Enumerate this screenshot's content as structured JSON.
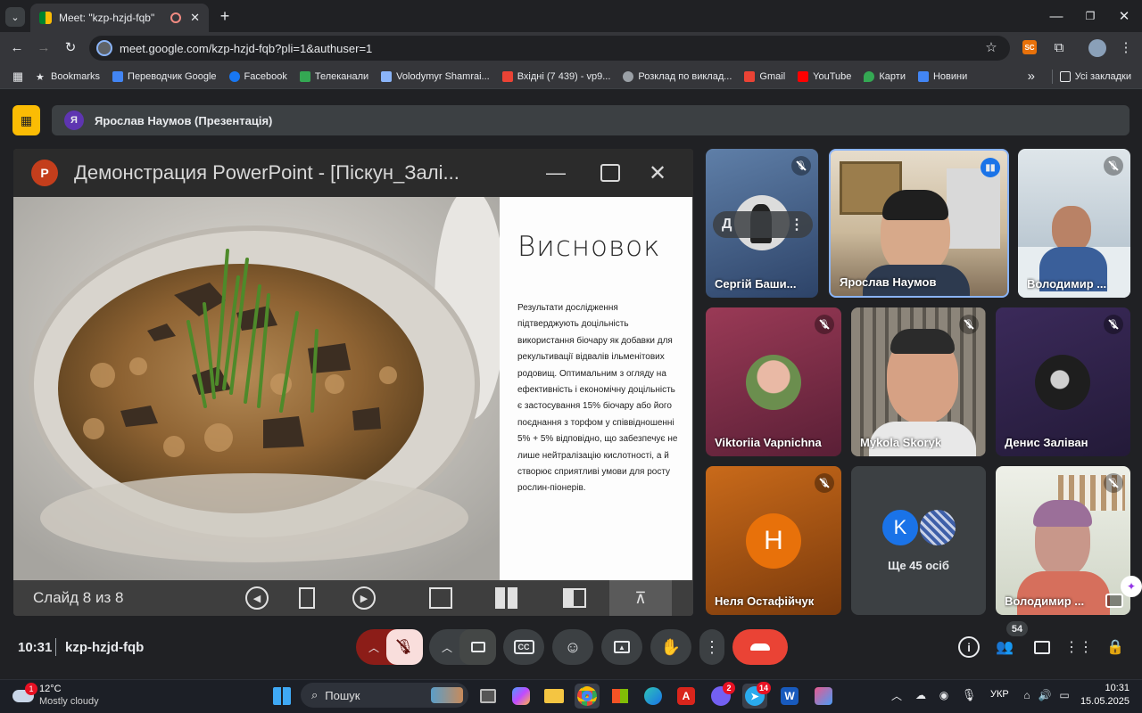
{
  "browser": {
    "tab_title": "Meet: \"kzp-hzjd-fqb\"",
    "url": "meet.google.com/kzp-hzjd-fqb?pli=1&authuser=1",
    "bookmarks": [
      "Bookmarks",
      "Переводчик Google",
      "Facebook",
      "Телеканали",
      "Volodymyr Shamrai...",
      "Вхідні (7 439) - vp9...",
      "Розклад по виклад...",
      "Gmail",
      "YouTube",
      "Карти",
      "Новини"
    ],
    "all_bookmarks": "Усі закладки",
    "ext_badge": "SC"
  },
  "meet": {
    "presenter_initial": "Я",
    "presenter_label": "Ярослав Наумов (Презентація)",
    "slide": {
      "window_title": "Демонстрация PowerPoint - [Піскун_Залі...",
      "heading": "Висновок",
      "body": "Результати дослідження підтверджують доцільність використання біочару як добавки для рекультивації відвалів ільменітових родовищ. Оптимальним з огляду на ефективність і економічну доцільність є застосування 15% біочару або його поєднання з торфом у співвідношенні 5% + 5% відповідно, що забезпечує не лише нейтралізацію кислотності, а й створює сприятливі умови для росту рослин-піонерів.",
      "counter": "Слайд 8 из 8"
    },
    "participants": [
      {
        "name": "Сергій Баши...",
        "overlay_letter": "Д"
      },
      {
        "name": "Ярослав Наумов"
      },
      {
        "name": "Володимир ..."
      },
      {
        "name": "Viktoriia Vapnichna"
      },
      {
        "name": "Mykola Skoryk"
      },
      {
        "name": "Денис Заліван"
      },
      {
        "name": "Неля Остафійчук",
        "initial": "Н"
      },
      {
        "name": "Ще 45 осіб",
        "initial": "K"
      },
      {
        "name": "Володимир ..."
      }
    ],
    "time": "10:31",
    "meeting_code": "kzp-hzjd-fqb",
    "people_count": "54"
  },
  "taskbar": {
    "weather_temp": "12°C",
    "weather_desc": "Mostly cloudy",
    "weather_badge": "1",
    "search_placeholder": "Пошук",
    "viber_badge": "2",
    "telegram_badge": "14",
    "lang": "УКР",
    "clock_time": "10:31",
    "clock_date": "15.05.2025"
  },
  "colors": {
    "accent_yellow": "#fbbc04",
    "end_call": "#ea4335",
    "mic_off": "#f9dedc",
    "avatar_orange": "#e8710a",
    "avatar_blue": "#1a73e8"
  }
}
